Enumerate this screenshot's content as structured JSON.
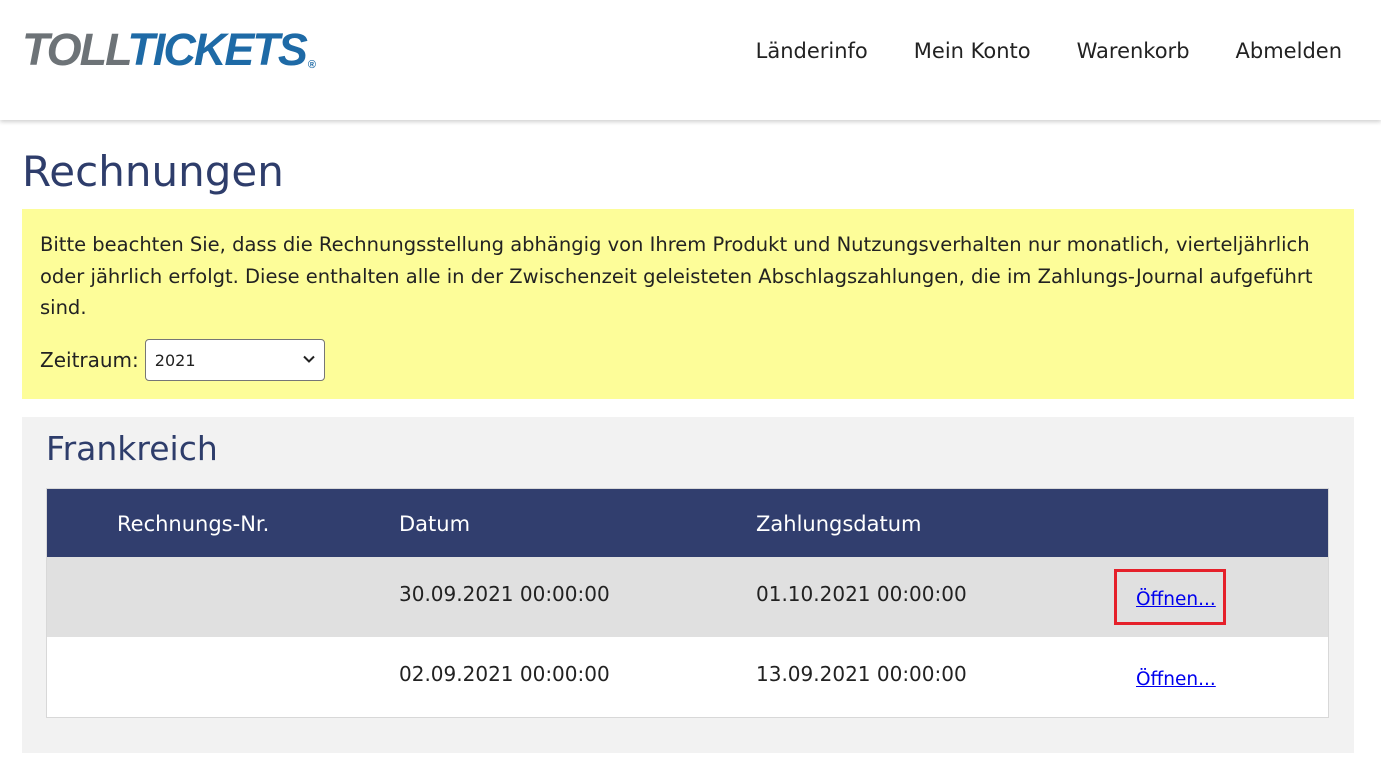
{
  "header": {
    "logo": {
      "part1": "TOLL",
      "part2": "TICKETS",
      "reg": "®"
    },
    "nav": [
      {
        "label": "Länderinfo"
      },
      {
        "label": "Mein Konto"
      },
      {
        "label": "Warenkorb"
      },
      {
        "label": "Abmelden"
      }
    ]
  },
  "page": {
    "title": "Rechnungen"
  },
  "notice": {
    "text": "Bitte beachten Sie, dass die Rechnungsstellung abhängig von Ihrem Produkt und Nutzungsverhalten nur monatlich, vierteljährlich oder jährlich erfolgt. Diese enthalten alle in der Zwischenzeit geleisteten Abschlagszahlungen, die im Zahlungs-Journal aufgeführt sind.",
    "period_label": "Zeitraum:",
    "period_value": "2021"
  },
  "country_section": {
    "title": "Frankreich",
    "columns": [
      "Rechnungs-Nr.",
      "Datum",
      "Zahlungsdatum",
      ""
    ],
    "rows": [
      {
        "number": "",
        "date": "30.09.2021 00:00:00",
        "payment_date": "01.10.2021 00:00:00",
        "action": "Öffnen..."
      },
      {
        "number": "",
        "date": "02.09.2021 00:00:00",
        "payment_date": "13.09.2021 00:00:00",
        "action": "Öffnen..."
      }
    ]
  },
  "colors": {
    "brand_gray": "#6d7377",
    "brand_blue": "#1e6aa6",
    "heading": "#2e3d6b",
    "table_header": "#313e6e",
    "notice_bg": "#fdfd99",
    "highlight": "#e5202a"
  },
  "icons": {
    "select_arrow": "chevron-down-icon"
  }
}
